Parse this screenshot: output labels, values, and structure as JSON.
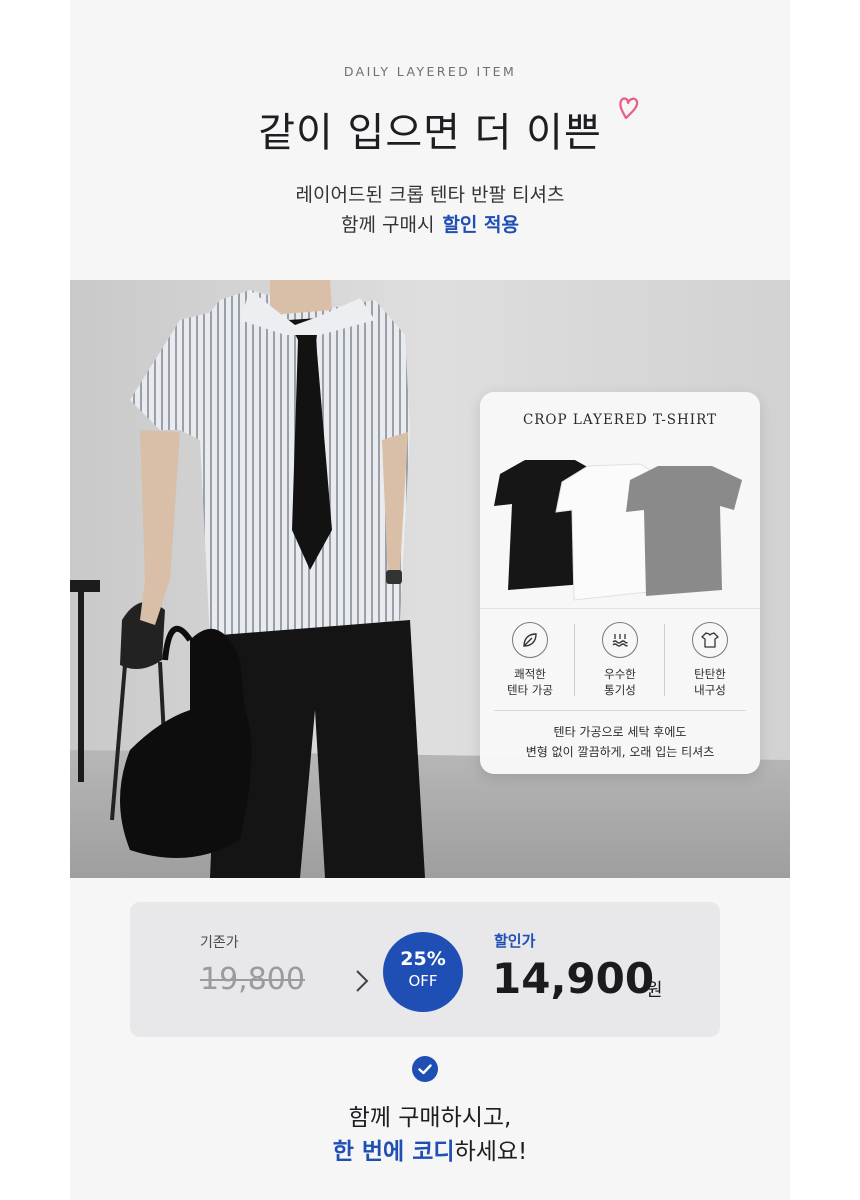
{
  "header": {
    "eyebrow": "DAILY LAYERED ITEM",
    "headline": "같이 입으면 더 이쁜",
    "subline_1": "레이어드된 크롭 텐타 반팔 티셔츠",
    "subline_2_prefix": "함께 구매시",
    "subline_2_accent": "할인 적용"
  },
  "card": {
    "title": "CROP LAYERED T-SHIRT",
    "colors": [
      "black",
      "white",
      "gray"
    ],
    "features": [
      {
        "icon": "leaf-icon",
        "line1": "쾌적한",
        "line2": "텐타 가공"
      },
      {
        "icon": "breathable-icon",
        "line1": "우수한",
        "line2": "통기성"
      },
      {
        "icon": "tshirt-icon",
        "line1": "탄탄한",
        "line2": "내구성"
      }
    ],
    "note_line1": "텐타 가공으로 세탁 후에도",
    "note_line2": "변형 없이 깔끔하게, 오래 입는 티셔츠"
  },
  "price": {
    "original_label": "기존가",
    "original_price": "19,800",
    "discount_pct": "25%",
    "discount_off": "OFF",
    "sale_label": "할인가",
    "sale_price": "14,900",
    "sale_unit": "원"
  },
  "cta": {
    "line1": "함께 구매하시고,",
    "line2_highlight": "한 번에 코디",
    "line2_rest": "하세요!"
  },
  "colors": {
    "accent": "#1f4fb5",
    "heart": "#e85c86",
    "background": "#f6f6f7"
  }
}
